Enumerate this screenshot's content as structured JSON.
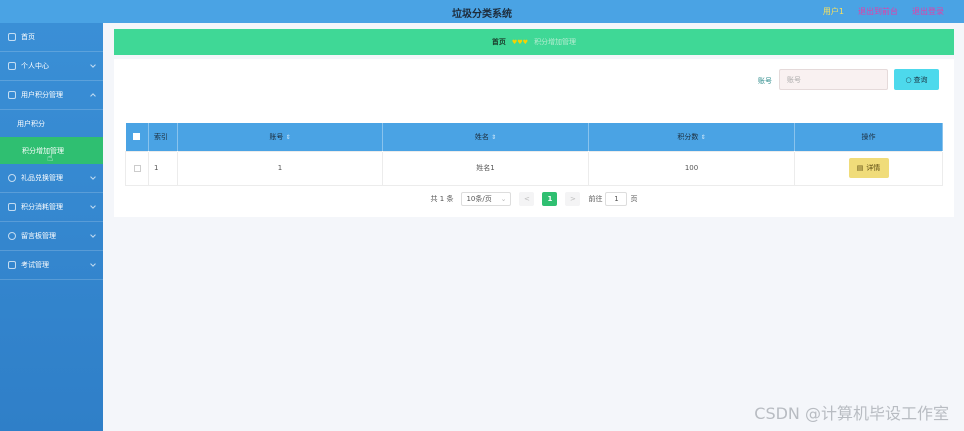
{
  "header": {
    "title": "垃圾分类系统",
    "user": "用户1",
    "links": [
      "退出到前台",
      "退出登录"
    ]
  },
  "sidebar": {
    "items": [
      {
        "label": "首页",
        "icon": "home-icon"
      },
      {
        "label": "个人中心",
        "icon": "user-icon"
      },
      {
        "label": "用户积分管理",
        "icon": "list-icon"
      }
    ],
    "sub_items": [
      "用户积分",
      "积分增加管理"
    ],
    "items_after": [
      {
        "label": "礼品兑换管理",
        "icon": "gift-icon"
      },
      {
        "label": "积分消耗管理",
        "icon": "grid-icon"
      },
      {
        "label": "留言板管理",
        "icon": "message-icon"
      },
      {
        "label": "考试管理",
        "icon": "doc-icon"
      }
    ]
  },
  "breadcrumb": {
    "home": "首页",
    "hearts": "♥♥♥",
    "current": "积分增加管理"
  },
  "search": {
    "label": "账号",
    "placeholder": "账号",
    "button": "查询"
  },
  "table": {
    "headers": [
      "索引",
      "账号",
      "姓名",
      "积分数",
      "操作"
    ],
    "rows": [
      {
        "index": "1",
        "account": "1",
        "name": "姓名1",
        "points": "100",
        "action": "详情"
      }
    ]
  },
  "pagination": {
    "total": "共 1 条",
    "page_size": "10条/页",
    "prev": "<",
    "page": "1",
    "next": ">",
    "goto_prefix": "前往",
    "goto_value": "1",
    "goto_suffix": "页"
  },
  "watermark": "CSDN @计算机毕设工作室",
  "colors": {
    "header": "#4aa3e4",
    "sidebar": "#3a8fd6",
    "active": "#2fbf71",
    "breadcrumb": "#3fd896",
    "search_button": "#4dd9ec",
    "detail_button": "#f0dc7a"
  }
}
